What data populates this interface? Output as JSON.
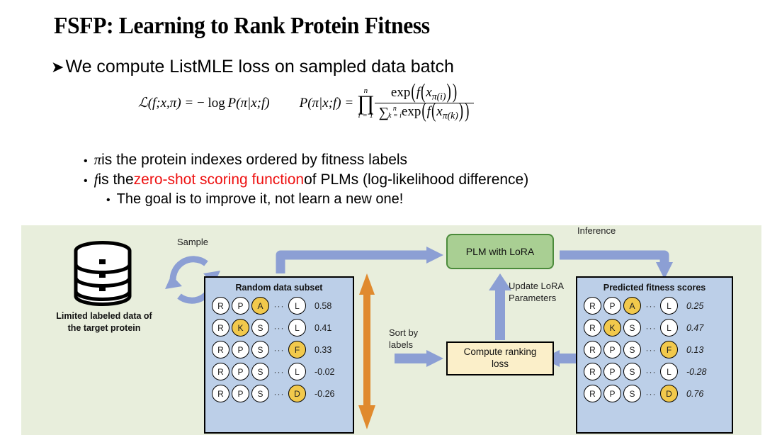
{
  "slide": {
    "title": "FSFP: Learning to Rank Protein Fitness",
    "bullet_marker": "➤",
    "bullet_main": "We compute ListMLE loss on sampled data batch",
    "sub_bullets": [
      {
        "symbol": "π",
        "rest": " is the protein indexes ordered by fitness labels"
      },
      {
        "symbol": "f",
        "pre": " is the ",
        "highlight": "zero-shot scoring function",
        "post": " of PLMs (log-likelihood difference)"
      },
      {
        "text": "The goal is to improve it, not learn a new one!"
      }
    ],
    "bullet_dot": "•"
  },
  "formula": {
    "lhs": {
      "script_l": "ℒ",
      "args": "(f;x,π) = ",
      "minus": "−",
      "log": "log",
      "prob": "P(π|x;f)"
    },
    "rhs": {
      "lead": "P(π|x;f) =",
      "prod_symbol": "∏",
      "prod_top": "n",
      "prod_bottom": "i = 1",
      "numerator": "exp",
      "num_inner_f": "f",
      "num_var": "x",
      "num_sub": "π(i)",
      "sum_symbol": "∑",
      "sum_top": "n",
      "sum_bottom": "k = i",
      "den_exp": "exp",
      "den_inner_f": "f",
      "den_var": "x",
      "den_sub": "π(k)"
    }
  },
  "diagram": {
    "db_caption": "Limited labeled data of\nthe target protein",
    "sample_label": "Sample",
    "plm_box": "PLM with LoRA",
    "loss_box": "Compute ranking\nloss",
    "label_inference": "Inference",
    "label_update": "Update LoRA\nParameters",
    "label_sort": "Sort by\nlabels",
    "left_box": {
      "title": "Random data subset",
      "rows": [
        {
          "residues": [
            {
              "c": "R",
              "hl": false
            },
            {
              "c": "P",
              "hl": false
            },
            {
              "c": "A",
              "hl": true
            }
          ],
          "ellipsis": "···",
          "last": {
            "c": "L",
            "hl": false
          },
          "score": "0.58"
        },
        {
          "residues": [
            {
              "c": "R",
              "hl": false
            },
            {
              "c": "K",
              "hl": true
            },
            {
              "c": "S",
              "hl": false
            }
          ],
          "ellipsis": "···",
          "last": {
            "c": "L",
            "hl": false
          },
          "score": "0.41"
        },
        {
          "residues": [
            {
              "c": "R",
              "hl": false
            },
            {
              "c": "P",
              "hl": false
            },
            {
              "c": "S",
              "hl": false
            }
          ],
          "ellipsis": "···",
          "last": {
            "c": "F",
            "hl": true
          },
          "score": "0.33"
        },
        {
          "residues": [
            {
              "c": "R",
              "hl": false
            },
            {
              "c": "P",
              "hl": false
            },
            {
              "c": "S",
              "hl": false
            }
          ],
          "ellipsis": "···",
          "last": {
            "c": "L",
            "hl": false
          },
          "score": "-0.02"
        },
        {
          "residues": [
            {
              "c": "R",
              "hl": false
            },
            {
              "c": "P",
              "hl": false
            },
            {
              "c": "S",
              "hl": false
            }
          ],
          "ellipsis": "···",
          "last": {
            "c": "D",
            "hl": true
          },
          "score": "-0.26"
        }
      ]
    },
    "right_box": {
      "title": "Predicted fitness scores",
      "rows": [
        {
          "residues": [
            {
              "c": "R",
              "hl": false
            },
            {
              "c": "P",
              "hl": false
            },
            {
              "c": "A",
              "hl": true
            }
          ],
          "ellipsis": "···",
          "last": {
            "c": "L",
            "hl": false
          },
          "score": "0.25"
        },
        {
          "residues": [
            {
              "c": "R",
              "hl": false
            },
            {
              "c": "K",
              "hl": true
            },
            {
              "c": "S",
              "hl": false
            }
          ],
          "ellipsis": "···",
          "last": {
            "c": "L",
            "hl": false
          },
          "score": "0.47"
        },
        {
          "residues": [
            {
              "c": "R",
              "hl": false
            },
            {
              "c": "P",
              "hl": false
            },
            {
              "c": "S",
              "hl": false
            }
          ],
          "ellipsis": "···",
          "last": {
            "c": "F",
            "hl": true
          },
          "score": "0.13"
        },
        {
          "residues": [
            {
              "c": "R",
              "hl": false
            },
            {
              "c": "P",
              "hl": false
            },
            {
              "c": "S",
              "hl": false
            }
          ],
          "ellipsis": "···",
          "last": {
            "c": "L",
            "hl": false
          },
          "score": "-0.28"
        },
        {
          "residues": [
            {
              "c": "R",
              "hl": false
            },
            {
              "c": "P",
              "hl": false
            },
            {
              "c": "S",
              "hl": false
            }
          ],
          "ellipsis": "···",
          "last": {
            "c": "D",
            "hl": true
          },
          "score": "0.76"
        }
      ]
    },
    "colors": {
      "panel_bg": "#e8eedc",
      "data_box": "#bccfe8",
      "plm_box": "#a9cf93",
      "plm_border": "#4b8b3b",
      "loss_box": "#fbefc9",
      "arrow_blue": "#8c9fd4",
      "arrow_orange": "#e08a2e",
      "highlight": "#f2c94c",
      "accent_red": "#ee1111"
    }
  }
}
